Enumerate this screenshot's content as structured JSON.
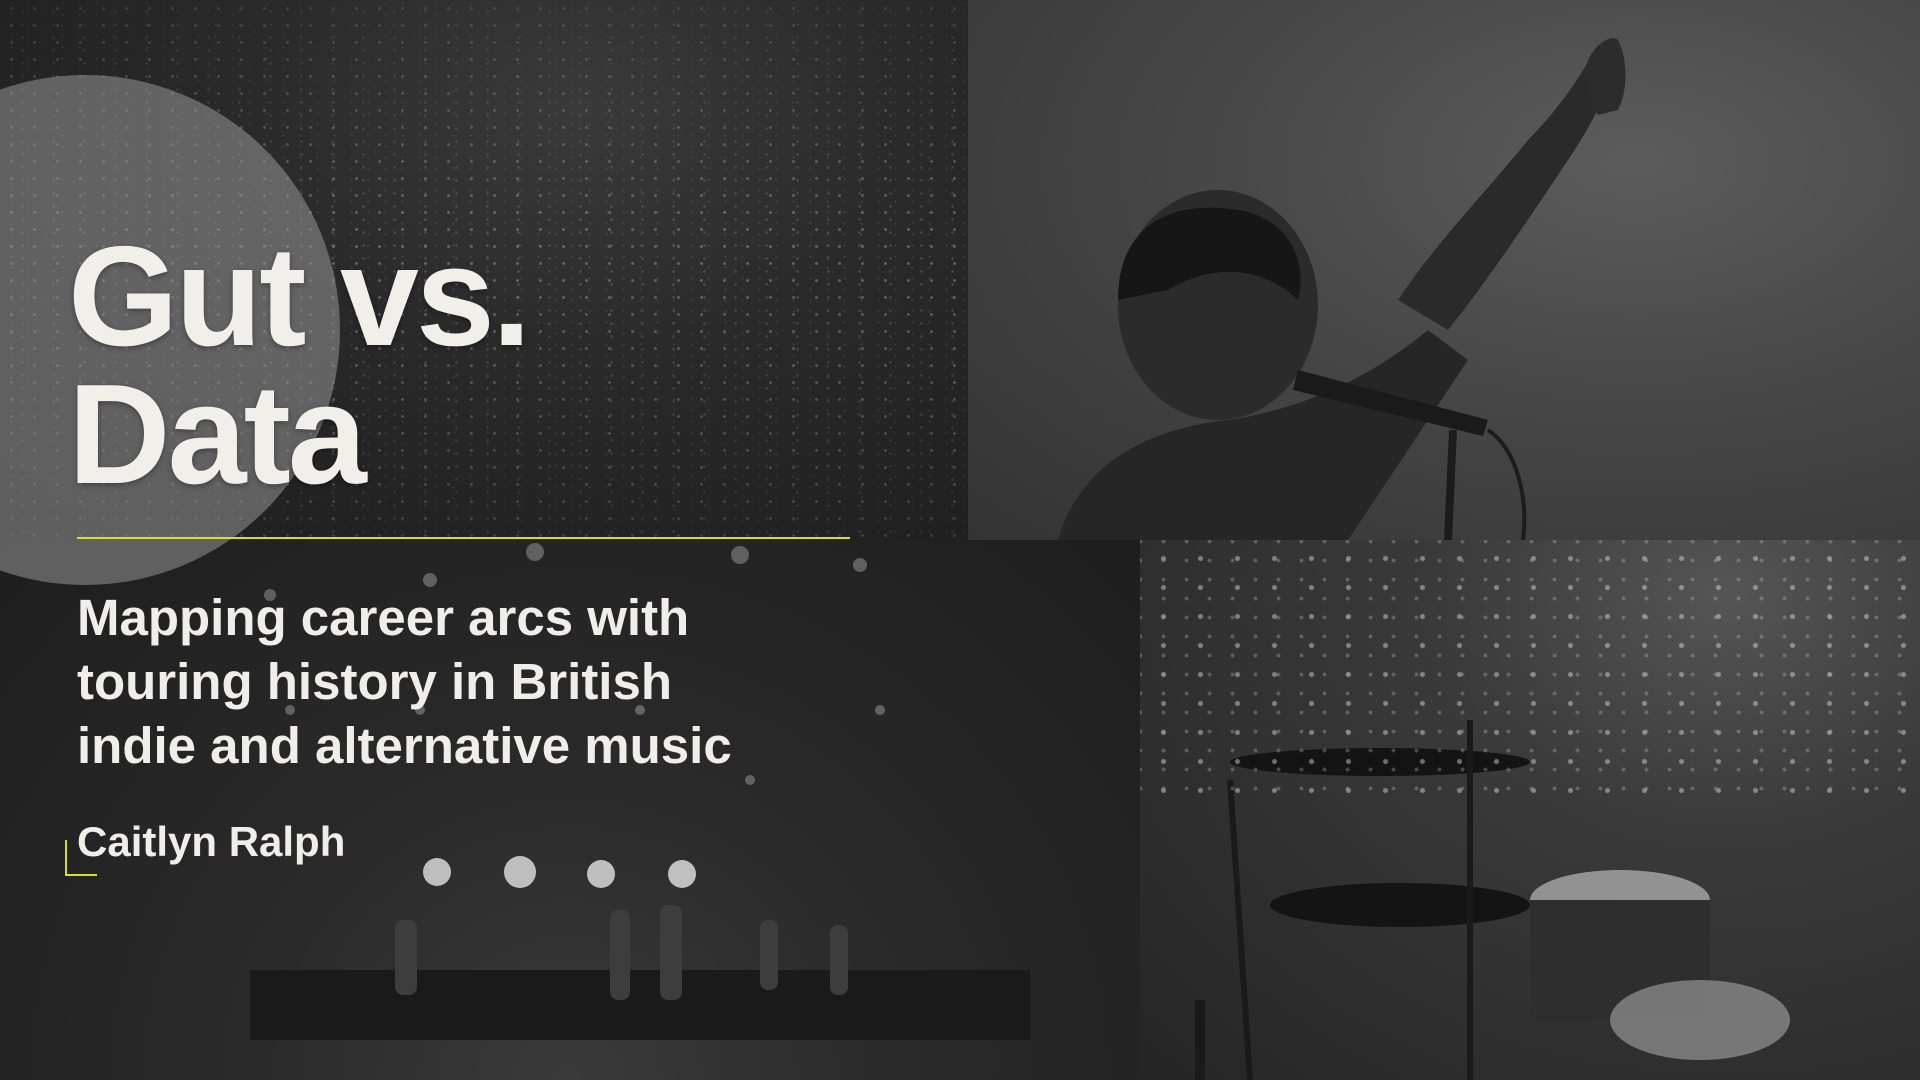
{
  "slide": {
    "title_lines": [
      "Gut vs.",
      "Data"
    ],
    "subtitle_lines": [
      "Mapping career arcs with",
      "touring history in British",
      "indie and alternative music"
    ],
    "author": "Caitlyn Ralph"
  },
  "images": [
    {
      "name": "crowd-phone-lights-photo",
      "style": "black-and-white"
    },
    {
      "name": "singer-with-microphone-photo",
      "style": "black-and-white"
    },
    {
      "name": "band-on-stage-photo",
      "style": "black-and-white"
    },
    {
      "name": "drum-kit-photo",
      "style": "black-and-white"
    }
  ],
  "colors": {
    "accent": "#d8dc2e",
    "text": "#f2efea",
    "background": "#222222"
  }
}
